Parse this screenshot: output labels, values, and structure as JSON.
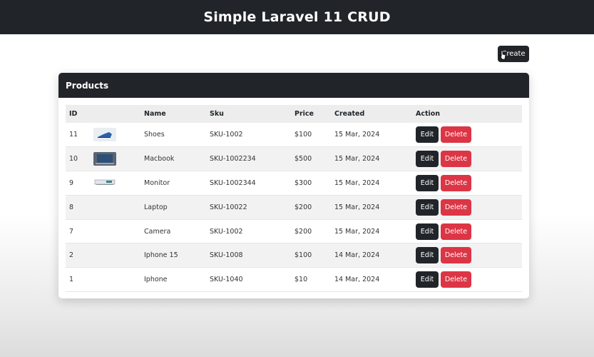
{
  "header": {
    "title": "Simple Laravel 11 CRUD"
  },
  "toolbar": {
    "create_label": "Create"
  },
  "card": {
    "title": "Products"
  },
  "table": {
    "columns": [
      "ID",
      "",
      "Name",
      "Sku",
      "Price",
      "Created",
      "Action"
    ],
    "rows": [
      {
        "id": "11",
        "image": "shoes-thumbnail",
        "name": "Shoes",
        "sku": "SKU-1002",
        "price": "$100",
        "created": "15 Mar, 2024"
      },
      {
        "id": "10",
        "image": "macbook-thumbnail",
        "name": "Macbook",
        "sku": "SKU-1002234",
        "price": "$500",
        "created": "15 Mar, 2024"
      },
      {
        "id": "9",
        "image": "monitor-thumbnail",
        "name": "Monitor",
        "sku": "SKU-1002344",
        "price": "$300",
        "created": "15 Mar, 2024"
      },
      {
        "id": "8",
        "image": "",
        "name": "Laptop",
        "sku": "SKU-10022",
        "price": "$200",
        "created": "15 Mar, 2024"
      },
      {
        "id": "7",
        "image": "",
        "name": "Camera",
        "sku": "SKU-1002",
        "price": "$200",
        "created": "15 Mar, 2024"
      },
      {
        "id": "2",
        "image": "",
        "name": "Iphone 15",
        "sku": "SKU-1008",
        "price": "$100",
        "created": "14 Mar, 2024"
      },
      {
        "id": "1",
        "image": "",
        "name": "Iphone",
        "sku": "SKU-1040",
        "price": "$10",
        "created": "14 Mar, 2024"
      }
    ],
    "edit_label": "Edit",
    "delete_label": "Delete"
  },
  "colors": {
    "dark": "#212529",
    "danger": "#dc3545"
  }
}
